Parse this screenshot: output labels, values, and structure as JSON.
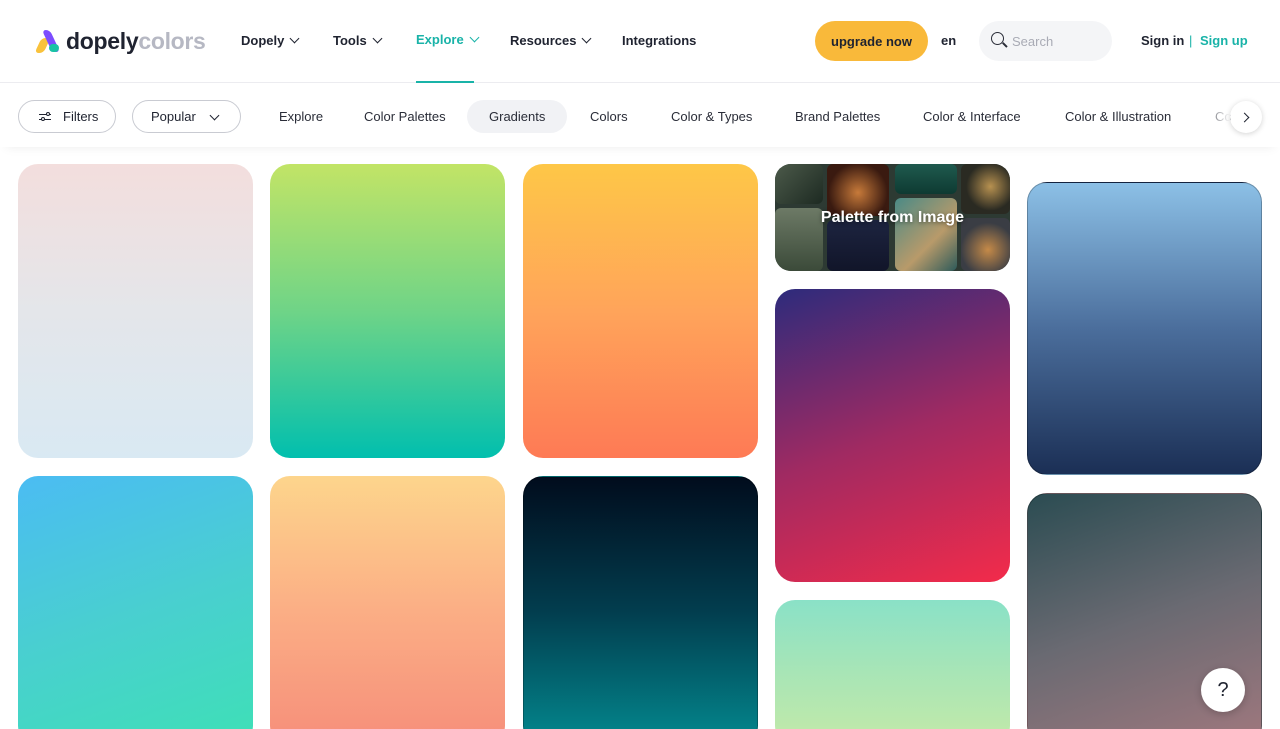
{
  "brand": {
    "name_bold": "dopely",
    "name_light": "colors"
  },
  "nav": {
    "items": [
      {
        "label": "Dopely",
        "has_dropdown": true,
        "active": false
      },
      {
        "label": "Tools",
        "has_dropdown": true,
        "active": false
      },
      {
        "label": "Explore",
        "has_dropdown": true,
        "active": true
      },
      {
        "label": "Resources",
        "has_dropdown": true,
        "active": false
      },
      {
        "label": "Integrations",
        "has_dropdown": false,
        "active": false
      }
    ],
    "upgrade_label": "upgrade now",
    "language": "en",
    "search_placeholder": "Search",
    "sign_in": "Sign in",
    "separator": "|",
    "sign_up": "Sign up"
  },
  "filterbar": {
    "filters_label": "Filters",
    "sort_value": "Popular",
    "categories": [
      {
        "label": "Explore",
        "active": false
      },
      {
        "label": "Color Palettes",
        "active": false
      },
      {
        "label": "Gradients",
        "active": true
      },
      {
        "label": "Colors",
        "active": false
      },
      {
        "label": "Color & Types",
        "active": false
      },
      {
        "label": "Brand Palettes",
        "active": false
      },
      {
        "label": "Color & Interface",
        "active": false
      },
      {
        "label": "Color & Illustration",
        "active": false
      },
      {
        "label": "Co",
        "active": false
      }
    ]
  },
  "palette_from_image": {
    "label": "Palette from Image"
  },
  "gradients": [
    {
      "id": "g1",
      "angle": "180deg",
      "colors": [
        "#f3dedd",
        "#e4e6ea",
        "#d9e9f3"
      ]
    },
    {
      "id": "g2",
      "angle": "180deg",
      "colors": [
        "#c2e466",
        "#6fd487",
        "#01bfae"
      ]
    },
    {
      "id": "g3",
      "angle": "180deg",
      "colors": [
        "#fec747",
        "#ffa45a",
        "#fe7a55"
      ]
    },
    {
      "id": "g4",
      "angle": "160deg",
      "colors": [
        "#2d2b7c",
        "#a02a62",
        "#f32b4a"
      ]
    },
    {
      "id": "g5",
      "angle": "180deg",
      "colors": [
        "#8cc0e6",
        "#4b6e9c",
        "#1b2f55"
      ]
    },
    {
      "id": "g6",
      "angle": "160deg",
      "colors": [
        "#4bbcf3",
        "#49cfd0",
        "#3ee0b6"
      ]
    },
    {
      "id": "g7",
      "angle": "180deg",
      "colors": [
        "#fdd58c",
        "#fbae85",
        "#f68e7a"
      ]
    },
    {
      "id": "g8",
      "angle": "180deg",
      "colors": [
        "#010c1d",
        "#023d4e",
        "#03898f"
      ]
    },
    {
      "id": "g9",
      "angle": "180deg",
      "colors": [
        "#8ae1c7",
        "#a8e5b6",
        "#c4eaa8"
      ]
    },
    {
      "id": "g10",
      "angle": "160deg",
      "colors": [
        "#2b4c52",
        "#6a6a72",
        "#a0787e"
      ]
    }
  ],
  "help_label": "?"
}
